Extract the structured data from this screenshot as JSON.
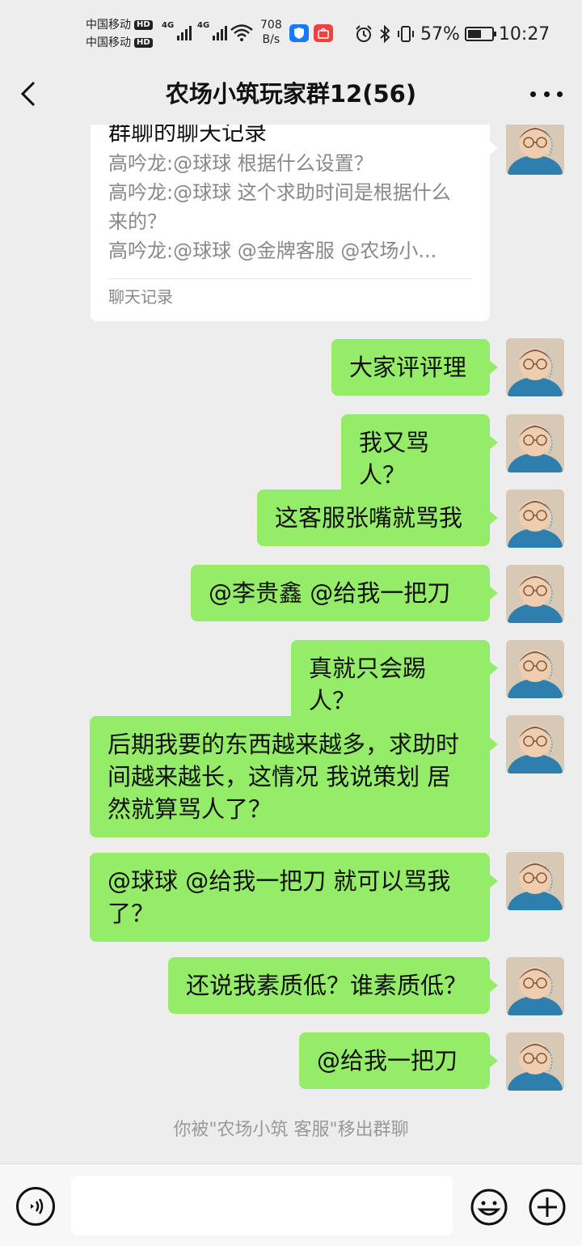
{
  "status_bar": {
    "carrier_1": "中国移动",
    "carrier_2": "中国移动",
    "hd": "HD",
    "net_1": "4G",
    "net_2": "4G",
    "speed_value": "708",
    "speed_unit": "B/s",
    "battery_percent": "57%",
    "battery_level": 0.57,
    "time": "10:27",
    "icons": [
      "alarm-icon",
      "bluetooth-icon",
      "vibrate-icon"
    ]
  },
  "header": {
    "title": "农场小筑玩家群12(56)",
    "back_icon": "chevron-left-icon",
    "more_icon": "more-dots-icon"
  },
  "chat_record_card": {
    "title": "群聊的聊天记录",
    "lines": [
      "高吟龙:@球球 根据什么设置？",
      "高吟龙:@球球 这个求助时间是根据什么",
      "来的？",
      "高吟龙:@球球 @金牌客服 @农场小..."
    ],
    "footer": "聊天记录"
  },
  "messages": [
    {
      "text": "大家评评理"
    },
    {
      "text": "我又骂人？"
    },
    {
      "text": "这客服张嘴就骂我"
    },
    {
      "text": "@李贵鑫  @给我一把刀"
    },
    {
      "text": "真就只会踢人？"
    },
    {
      "text": "后期我要的东西越来越多，求助时间越来越长，这情况 我说策划 居然就算骂人了？"
    },
    {
      "text": "@球球  @给我一把刀   就可以骂我了？"
    },
    {
      "text": "还说我素质低？谁素质低？"
    },
    {
      "text": "@给我一把刀"
    }
  ],
  "system_message": "你被\"农场小筑 客服\"移出群聊",
  "input_bar": {
    "voice_icon": "voice-icon",
    "emoji_icon": "emoji-icon",
    "plus_icon": "plus-icon"
  },
  "colors": {
    "background": "#ededed",
    "bubble_green": "#95ec69",
    "card_white": "#ffffff",
    "system_text": "#999999"
  }
}
